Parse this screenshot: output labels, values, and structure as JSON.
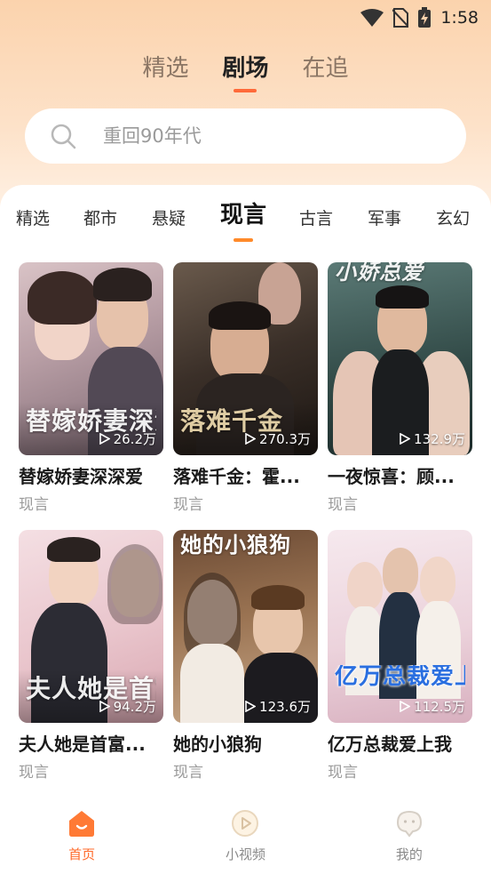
{
  "status_bar": {
    "time": "1:58"
  },
  "top_tabs": [
    {
      "label": "精选",
      "active": false
    },
    {
      "label": "剧场",
      "active": true
    },
    {
      "label": "在追",
      "active": false
    }
  ],
  "search": {
    "placeholder": "重回90年代"
  },
  "category_tabs": [
    {
      "label": "精选",
      "active": false
    },
    {
      "label": "都市",
      "active": false
    },
    {
      "label": "悬疑",
      "active": false
    },
    {
      "label": "现言",
      "active": true
    },
    {
      "label": "古言",
      "active": false
    },
    {
      "label": "军事",
      "active": false
    },
    {
      "label": "玄幻",
      "active": false
    }
  ],
  "dramas": [
    {
      "title": "替嫁娇妻深深爱",
      "tag": "现言",
      "views": "26.2万",
      "poster_text": "替嫁娇妻深深爱"
    },
    {
      "title": "落难千金：霍...",
      "tag": "现言",
      "views": "270.3万",
      "poster_text": "落难千金"
    },
    {
      "title": "一夜惊喜：顾...",
      "tag": "现言",
      "views": "132.9万",
      "poster_text": "小娇总爱"
    },
    {
      "title": "夫人她是首富...",
      "tag": "现言",
      "views": "94.2万",
      "poster_text": "夫人她是首富"
    },
    {
      "title": "她的小狼狗",
      "tag": "现言",
      "views": "123.6万",
      "poster_text": "她的小狼狗"
    },
    {
      "title": "亿万总裁爱上我",
      "tag": "现言",
      "views": "112.5万",
      "poster_text": "亿万总裁爱上我"
    }
  ],
  "bottom_nav": [
    {
      "label": "首页",
      "icon": "home-icon",
      "active": true
    },
    {
      "label": "小视频",
      "icon": "video-icon",
      "active": false
    },
    {
      "label": "我的",
      "icon": "profile-icon",
      "active": false
    }
  ],
  "colors": {
    "accent": "#ff6a2a",
    "header_bg": "#fbd3ad"
  }
}
